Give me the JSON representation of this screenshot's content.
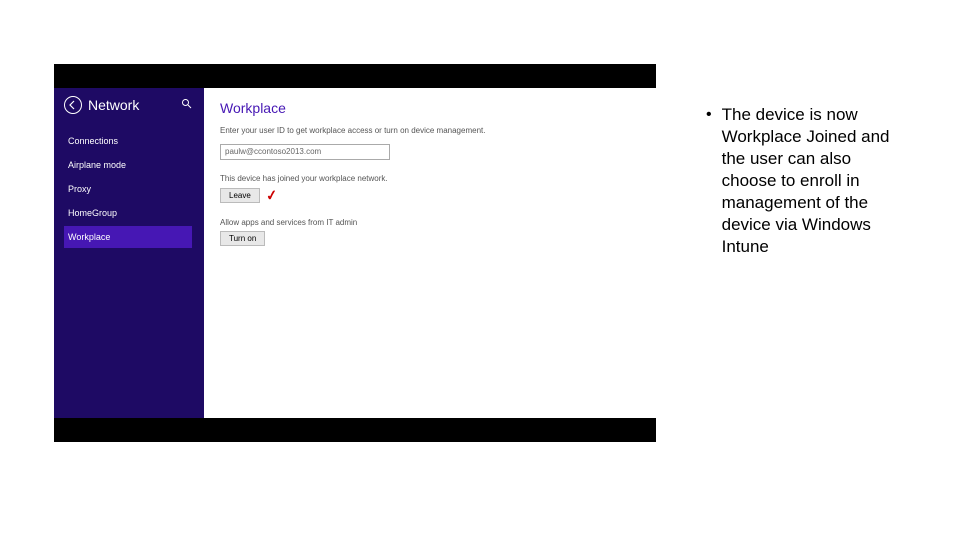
{
  "screenshot": {
    "sidebar": {
      "title": "Network",
      "items": [
        {
          "label": "Connections",
          "active": false
        },
        {
          "label": "Airplane mode",
          "active": false
        },
        {
          "label": "Proxy",
          "active": false
        },
        {
          "label": "HomeGroup",
          "active": false
        },
        {
          "label": "Workplace",
          "active": true
        }
      ]
    },
    "content": {
      "title": "Workplace",
      "subtext": "Enter your user ID to get workplace access or turn on device management.",
      "input_value": "paulw@ccontoso2013.com",
      "joined_label": "This device has joined your workplace network.",
      "leave_button": "Leave",
      "allow_label": "Allow apps and services from IT admin",
      "turnon_button": "Turn on"
    }
  },
  "bullet": "The device is now Workplace Joined and the user can also choose to enroll in management of the device via Windows Intune"
}
